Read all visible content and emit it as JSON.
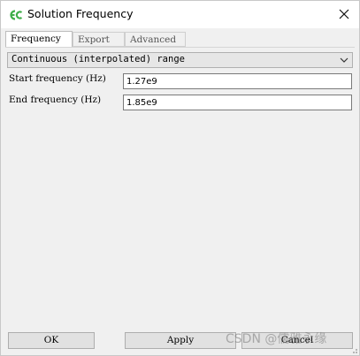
{
  "window": {
    "title": "Solution Frequency",
    "app_icon": "ec-logo-icon",
    "close_icon": "close-icon"
  },
  "tabs": [
    {
      "label": "Frequency",
      "active": true
    },
    {
      "label": "Export",
      "active": false
    },
    {
      "label": "Advanced",
      "active": false
    }
  ],
  "frequency": {
    "range_type": {
      "value": "Continuous (interpolated) range",
      "icon": "chevron-down-icon"
    },
    "start": {
      "label": "Start frequency (Hz)",
      "value": "1.27e9"
    },
    "end": {
      "label": "End frequency (Hz)",
      "value": "1.85e9"
    }
  },
  "buttons": {
    "ok": "OK",
    "apply": "Apply",
    "cancel": "Cancel"
  },
  "watermark": "CSDN @儒雅永缘",
  "colors": {
    "logo_green": "#3fae49",
    "dialog_bg": "#f0f0f0",
    "button_bg": "#e1e1e1"
  }
}
